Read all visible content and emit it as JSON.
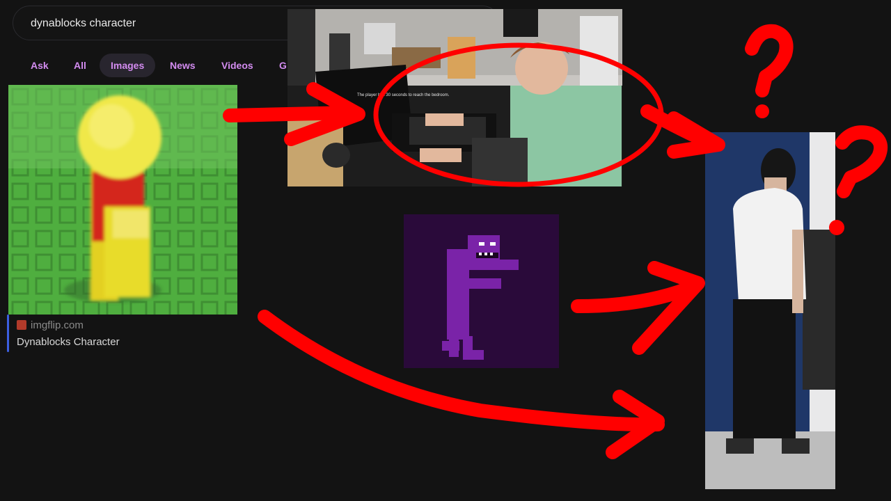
{
  "search": {
    "query": "dynablocks character"
  },
  "tabs": [
    {
      "label": "Ask"
    },
    {
      "label": "All"
    },
    {
      "label": "Images"
    },
    {
      "label": "News"
    },
    {
      "label": "Videos"
    },
    {
      "label": "G"
    }
  ],
  "result": {
    "source": "imgflip.com",
    "title": "Dynablocks Character",
    "favicon_icon": "imgflip-favicon"
  },
  "monitor_text": "The player has 30 seconds to reach the bedroom.",
  "annotations": {
    "color": "#ff0000",
    "question_mark": "?"
  }
}
